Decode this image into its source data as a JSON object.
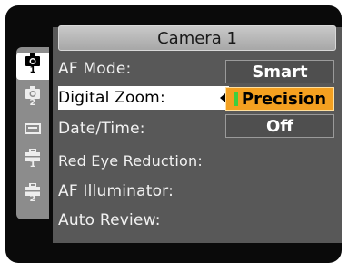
{
  "menu": {
    "title": "Camera 1",
    "items": [
      {
        "label": "AF Mode:",
        "selected": false
      },
      {
        "label": "Digital Zoom:",
        "selected": true
      },
      {
        "label": "Date/Time:",
        "selected": false
      },
      {
        "label": "Red Eye Reduction:",
        "selected": false
      },
      {
        "label": "AF Illuminator:",
        "selected": false
      },
      {
        "label": "Auto Review:",
        "selected": false
      }
    ]
  },
  "options": {
    "items": [
      "Smart",
      "Precision",
      "Off"
    ],
    "highlighted": "Precision"
  },
  "sidebar": {
    "tabs": [
      {
        "icon": "camera-icon",
        "sub": "1",
        "active": true
      },
      {
        "icon": "camera-icon",
        "sub": "2",
        "active": false
      },
      {
        "icon": "memory-card-icon",
        "sub": "",
        "active": false
      },
      {
        "icon": "toolbox-icon",
        "sub": "1",
        "active": false
      },
      {
        "icon": "toolbox-icon",
        "sub": "2",
        "active": false
      }
    ]
  },
  "colors": {
    "highlight": "#f4a020",
    "panel": "#585858",
    "title_bar": "#b8b8b8"
  }
}
